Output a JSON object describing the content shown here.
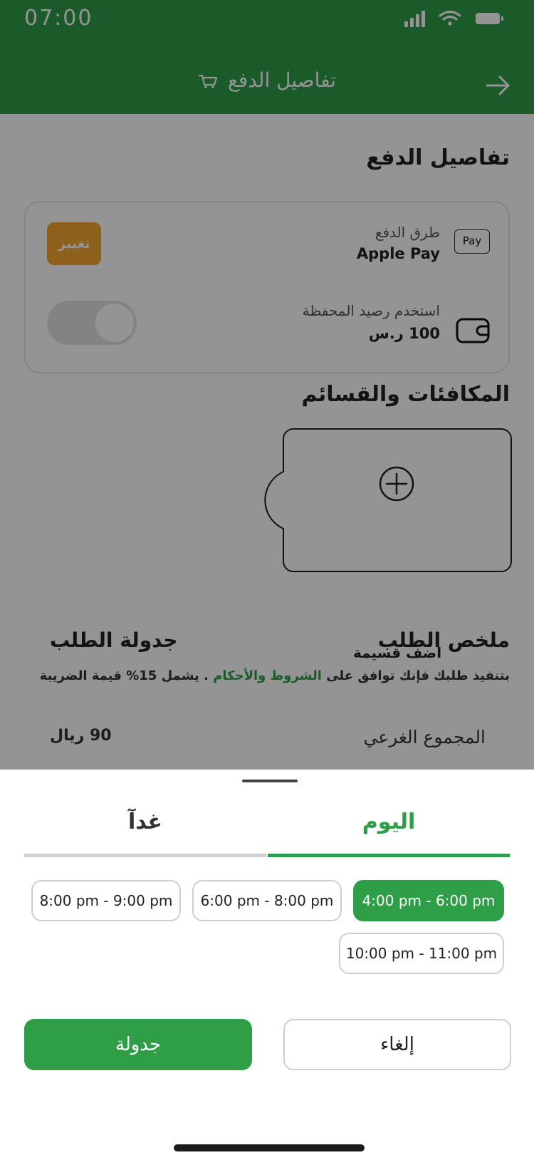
{
  "status_bar": {
    "time": "07:00"
  },
  "header": {
    "title": "تفاصيل الدفع"
  },
  "payment_details": {
    "section_title": "تفاصيل الدفع",
    "method_label": "طرق الدفع",
    "method_value": "Apple Pay",
    "apple_pay_badge": "Pay",
    "change_label": "تغيير",
    "wallet_label": "استخدم رصيد المحفظة",
    "wallet_value": "100 ر.س",
    "wallet_toggle_on": false
  },
  "rewards": {
    "section_title": "المكافئات والقسائم",
    "add_coupon_label": "اضف قسيمة"
  },
  "summary": {
    "title": "ملخص الطلب",
    "schedule_title": "جدولة الطلب",
    "terms_prefix": "بتنفيذ طلبك فإنك توافق على",
    "terms_link": "الشروط والأحكام",
    "terms_suffix": ". يشمل 15% قيمة الضريبة",
    "subtotal_label": "المجموع الغرعي",
    "subtotal_value": "90 ريال"
  },
  "sheet": {
    "tabs": [
      {
        "label": "اليوم",
        "selected": true
      },
      {
        "label": "غدآ",
        "selected": false
      }
    ],
    "slots": [
      {
        "label": "4:00 pm - 6:00 pm",
        "selected": true
      },
      {
        "label": "6:00 pm - 8:00 pm",
        "selected": false
      },
      {
        "label": "8:00 pm - 9:00 pm",
        "selected": false
      },
      {
        "label": "10:00 pm - 11:00 pm",
        "selected": false
      }
    ],
    "cancel_label": "إلغاء",
    "schedule_label": "جدولة"
  },
  "colors": {
    "brand_green": "#2e9e47",
    "accent_orange": "#f3a630",
    "overlay": "rgba(0,0,0,0.42)"
  },
  "icons": [
    "signal-icon",
    "wifi-icon",
    "battery-icon",
    "back-arrow-icon",
    "cart-icon",
    "apple-pay-icon",
    "wallet-icon",
    "add-circle-icon"
  ]
}
